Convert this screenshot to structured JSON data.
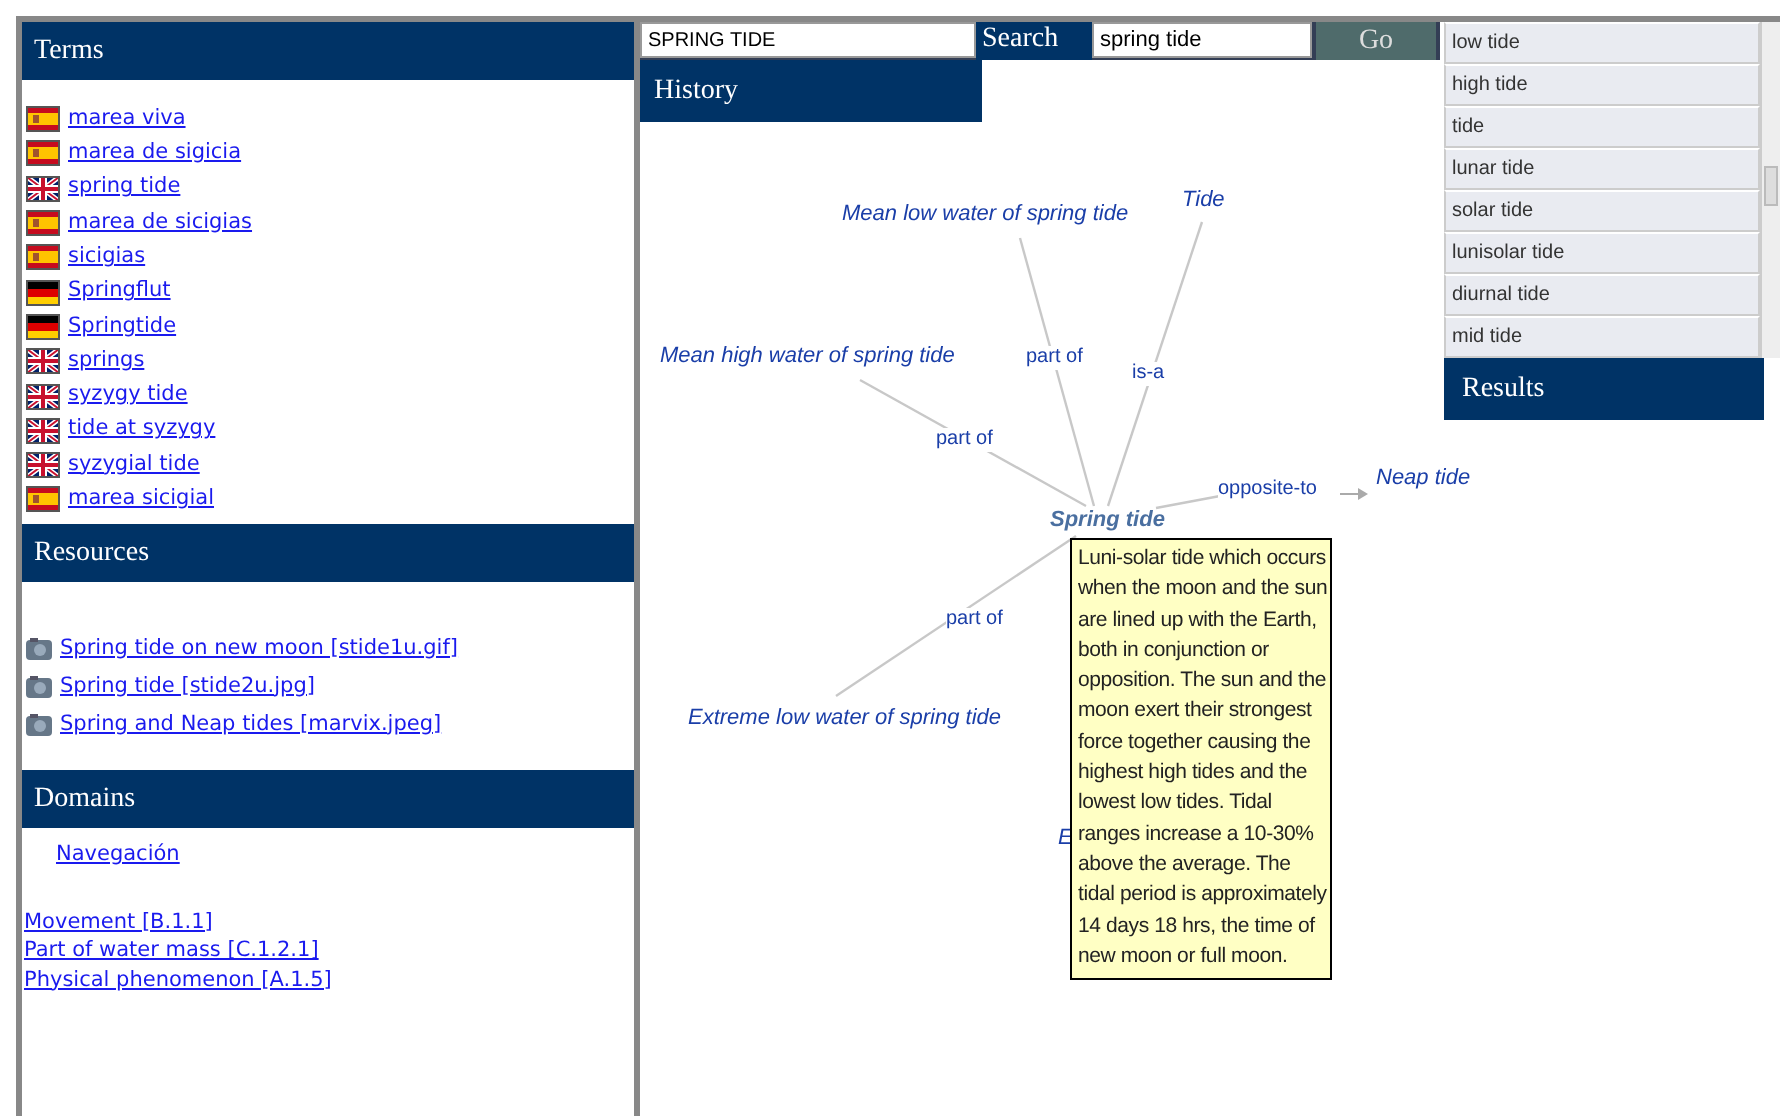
{
  "terms": {
    "title": "Terms",
    "items": [
      {
        "kind": "spain",
        "label": "marea viva"
      },
      {
        "kind": "spain",
        "label": "marea de sigicia"
      },
      {
        "kind": "britain",
        "label": "spring tide"
      },
      {
        "kind": "spain",
        "label": "marea de sicigias"
      },
      {
        "kind": "spain",
        "label": "sicigias"
      },
      {
        "kind": "germany",
        "label": "Springflut"
      },
      {
        "kind": "germany",
        "label": "Springtide"
      },
      {
        "kind": "britain",
        "label": "springs"
      },
      {
        "kind": "britain",
        "label": "syzygy tide"
      },
      {
        "kind": "britain",
        "label": "tide at syzygy"
      },
      {
        "kind": "britain",
        "label": "syzygial tide"
      },
      {
        "kind": "spain",
        "label": "marea sicigial"
      }
    ]
  },
  "resources": {
    "title": "Resources",
    "items": [
      "Spring tide on new moon [stide1u.gif]",
      "Spring tide [stide2u.jpg]",
      "Spring and Neap tides [marvix.jpeg]"
    ]
  },
  "domains": {
    "title": "Domains",
    "navigation": "Navegación",
    "items": [
      "Movement [B.1.1]",
      "Part of water mass [C.1.2.1]",
      "Physical phenomenon [A.1.5]"
    ]
  },
  "search": {
    "current": "SPRING TIDE",
    "label": "Search",
    "query": "spring tide",
    "button": "Go"
  },
  "history": {
    "title": "History"
  },
  "graph": {
    "nodes": [
      {
        "label": "Tide",
        "kind": "term"
      },
      {
        "label": "Mean low water of spring tide",
        "kind": "term"
      },
      {
        "label": "Mean high water of spring tide",
        "kind": "term"
      },
      {
        "label": "Spring tide",
        "kind": "focus"
      },
      {
        "label": "Neap tide",
        "kind": "term"
      },
      {
        "label": "Extreme low water of spring tide",
        "kind": "term"
      },
      {
        "label": "E",
        "kind": "term"
      }
    ],
    "edges": [
      {
        "label": "part of"
      },
      {
        "label": "is-a"
      },
      {
        "label": "part of"
      },
      {
        "label": "opposite-to"
      },
      {
        "label": "part of"
      }
    ],
    "tooltip": "Luni-solar tide which occurs when the moon and the sun are lined up with the Earth, both in conjunction or opposition. The sun and the moon exert their strongest force together causing the highest high tides and the lowest low tides. Tidal ranges increase a 10-30% above the average. The tidal period is approximately 14 days 18 hrs, the time of new moon or full moon."
  },
  "results": {
    "items": [
      "low tide",
      "high tide",
      "tide",
      "lunar tide",
      "solar tide",
      "lunisolar tide",
      "diurnal tide",
      "mid tide"
    ],
    "title": "Results"
  }
}
